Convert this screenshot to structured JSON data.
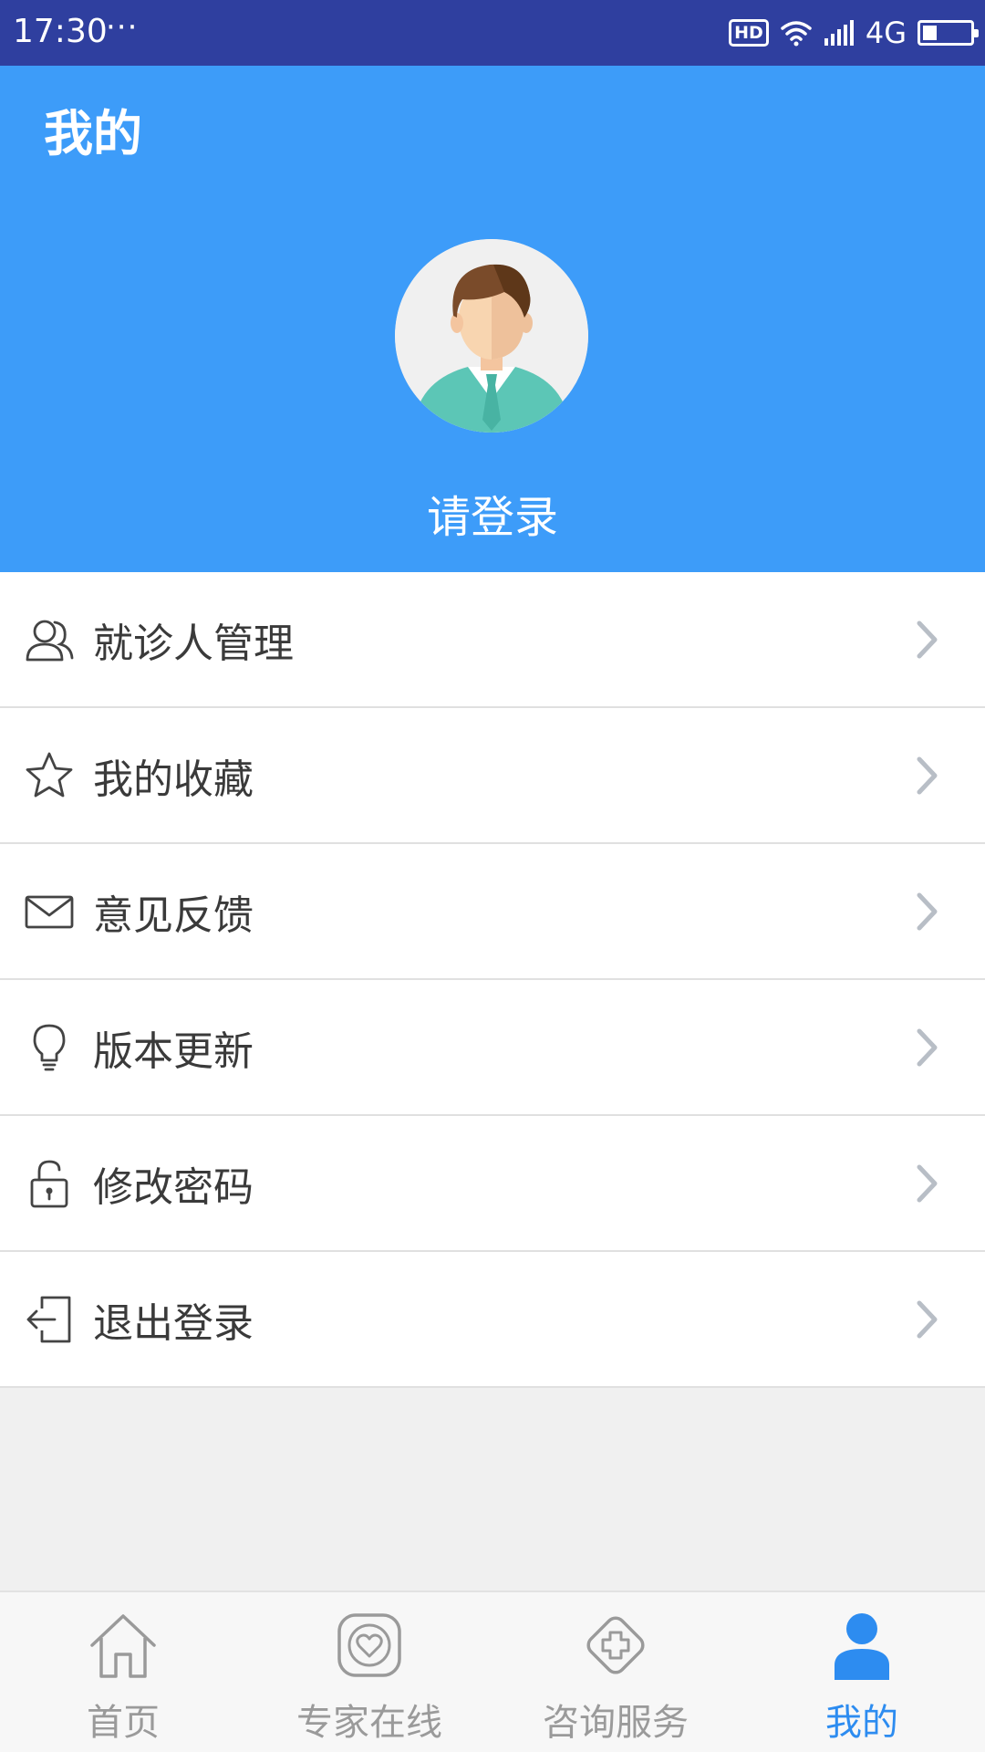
{
  "status_bar": {
    "time": "17:30",
    "more": "···",
    "hd": "HD",
    "network": "4G",
    "battery_level": 0.3
  },
  "header": {
    "title": "我的",
    "login_prompt": "请登录",
    "background_color": "#3d9cf9"
  },
  "menu": {
    "items": [
      {
        "label": "就诊人管理",
        "icon": "users-icon"
      },
      {
        "label": "我的收藏",
        "icon": "star-icon"
      },
      {
        "label": "意见反馈",
        "icon": "mail-icon"
      },
      {
        "label": "版本更新",
        "icon": "lightbulb-icon"
      },
      {
        "label": "修改密码",
        "icon": "lock-icon"
      },
      {
        "label": "退出登录",
        "icon": "logout-icon"
      }
    ]
  },
  "tabbar": {
    "active_color": "#2d8cf0",
    "inactive_color": "#9a9a9a",
    "tabs": [
      {
        "label": "首页",
        "icon": "home-icon",
        "active": false
      },
      {
        "label": "专家在线",
        "icon": "heart-chat-icon",
        "active": false
      },
      {
        "label": "咨询服务",
        "icon": "medical-cross-icon",
        "active": false
      },
      {
        "label": "我的",
        "icon": "person-icon",
        "active": true
      }
    ]
  }
}
